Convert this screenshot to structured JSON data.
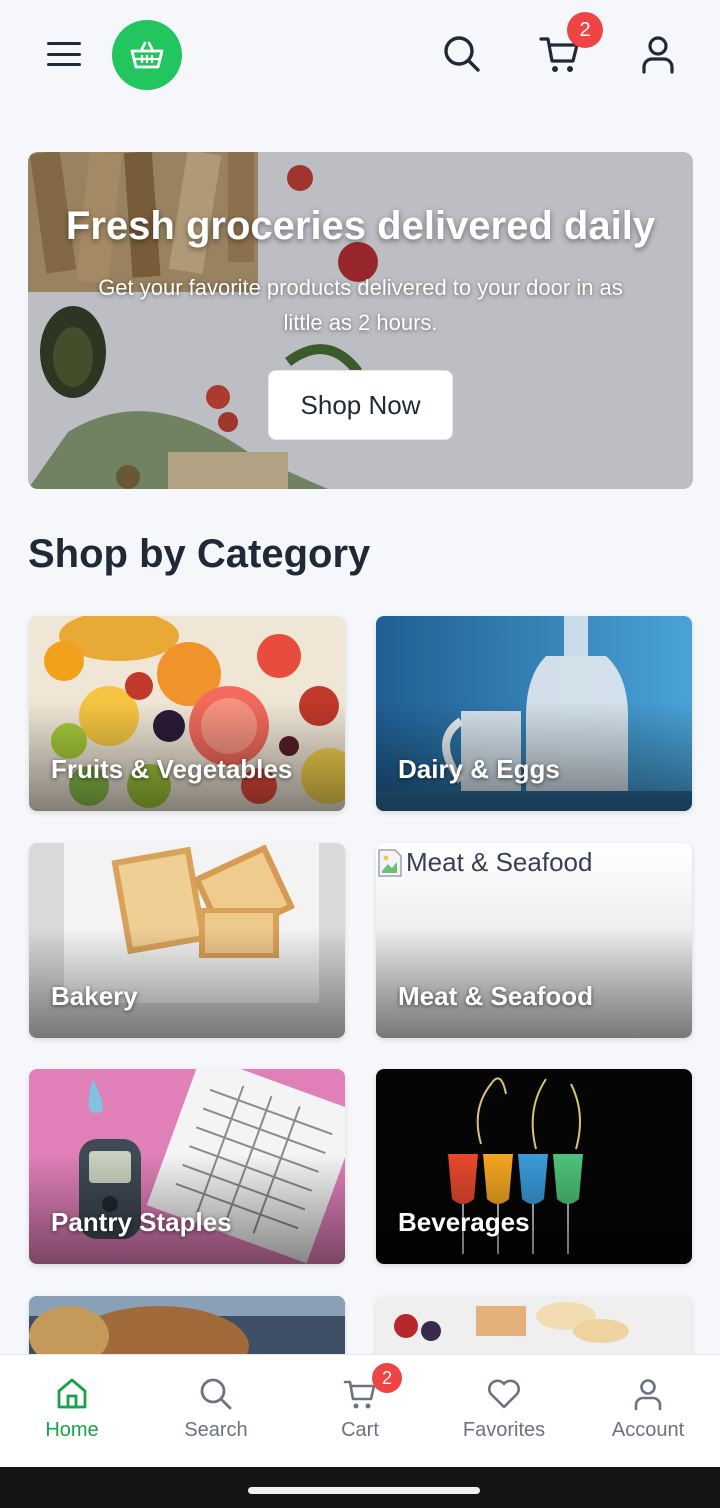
{
  "header": {
    "menu_icon": "menu-icon",
    "logo_icon": "basket-icon",
    "search_icon": "search-icon",
    "cart_icon": "cart-icon",
    "cart_badge": "2",
    "account_icon": "user-icon",
    "brand_color": "#22c55e",
    "badge_color": "#ef4444"
  },
  "hero": {
    "title": "Fresh groceries delivered daily",
    "subtitle": "Get your favorite products delivered to your door in as little as 2 hours.",
    "cta_label": "Shop Now"
  },
  "categories": {
    "title": "Shop by Category",
    "items": [
      {
        "label": "Fruits & Vegetables"
      },
      {
        "label": "Dairy & Eggs"
      },
      {
        "label": "Bakery"
      },
      {
        "label": "Meat & Seafood",
        "broken_image_alt": "Meat & Seafood"
      },
      {
        "label": "Pantry Staples"
      },
      {
        "label": "Beverages"
      }
    ]
  },
  "bottom_nav": {
    "active_color": "#16a34a",
    "items": [
      {
        "label": "Home",
        "icon": "home-icon",
        "active": true
      },
      {
        "label": "Search",
        "icon": "search-icon"
      },
      {
        "label": "Cart",
        "icon": "cart-icon",
        "badge": "2"
      },
      {
        "label": "Favorites",
        "icon": "heart-icon"
      },
      {
        "label": "Account",
        "icon": "user-icon"
      }
    ]
  }
}
